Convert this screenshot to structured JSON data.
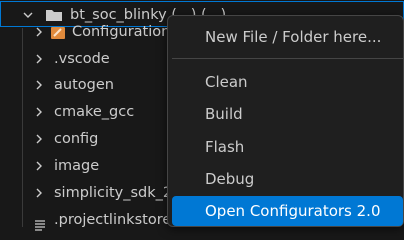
{
  "explorer": {
    "root": {
      "label": "bt_soc_blinky (...) (...)"
    },
    "items": [
      {
        "label": "Configuration"
      },
      {
        "label": ".vscode"
      },
      {
        "label": "autogen"
      },
      {
        "label": "cmake_gcc"
      },
      {
        "label": "config"
      },
      {
        "label": "image"
      },
      {
        "label": "simplicity_sdk_2..."
      },
      {
        "label": ".projectlinkstore"
      }
    ]
  },
  "context_menu": {
    "items": [
      {
        "label": "New File / Folder here..."
      },
      {
        "label": "Clean"
      },
      {
        "label": "Build"
      },
      {
        "label": "Flash"
      },
      {
        "label": "Debug"
      },
      {
        "label": "Open Configurators 2.0"
      }
    ],
    "active_index": 5
  },
  "colors": {
    "accent": "#0078d4",
    "background": "#181818",
    "menu_background": "#1f1f1f",
    "text": "#cccccc",
    "folder_icon": "#d7c27e"
  }
}
